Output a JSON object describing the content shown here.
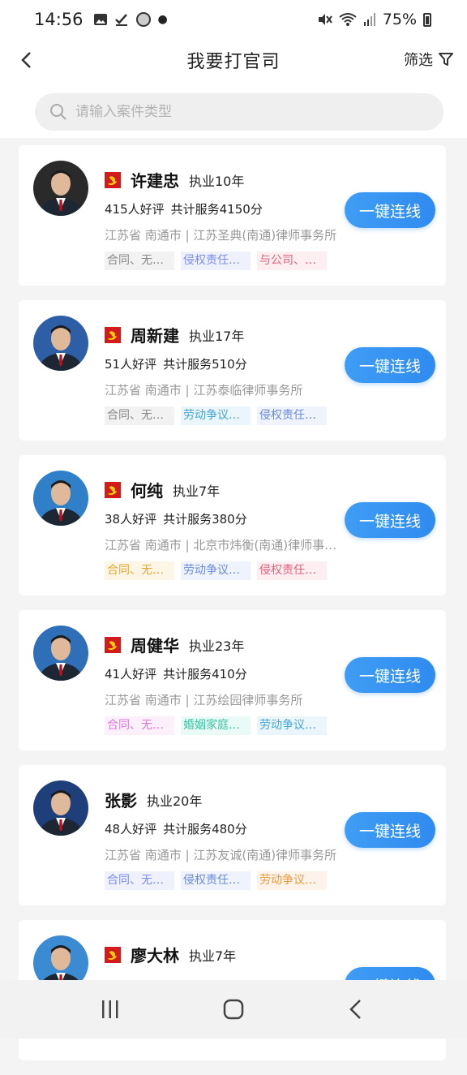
{
  "status": {
    "time": "14:56",
    "battery": "75%"
  },
  "header": {
    "title": "我要打官司",
    "filter_label": "筛选"
  },
  "search": {
    "placeholder": "请输入案件类型"
  },
  "connect_label": "一键连线",
  "lawyers": [
    {
      "name": "许建忠",
      "party": true,
      "years": "执业10年",
      "reviews": "415人好评",
      "service": "共计服务4150分",
      "location": "江苏省  南通市 | 江苏圣典(南通)律师事务所",
      "tags": [
        {
          "text": "合同、无…",
          "style": "gray"
        },
        {
          "text": "侵权责任…",
          "style": "bluepurple"
        },
        {
          "text": "与公司、…",
          "style": "red"
        }
      ]
    },
    {
      "name": "周新建",
      "party": true,
      "years": "执业17年",
      "reviews": "51人好评",
      "service": "共计服务510分",
      "location": "江苏省  南通市 | 江苏泰临律师事务所",
      "tags": [
        {
          "text": "合同、无…",
          "style": "gray"
        },
        {
          "text": "劳动争议…",
          "style": "teal"
        },
        {
          "text": "侵权责任…",
          "style": "blue"
        }
      ]
    },
    {
      "name": "何纯",
      "party": true,
      "years": "执业7年",
      "reviews": "38人好评",
      "service": "共计服务380分",
      "location": "江苏省  南通市 | 北京市炜衡(南通)律师事务所",
      "tags": [
        {
          "text": "合同、无…",
          "style": "yellow"
        },
        {
          "text": "劳动争议…",
          "style": "blue"
        },
        {
          "text": "侵权责任…",
          "style": "red"
        }
      ]
    },
    {
      "name": "周健华",
      "party": true,
      "years": "执业23年",
      "reviews": "41人好评",
      "service": "共计服务410分",
      "location": "江苏省  南通市 | 江苏绘园律师事务所",
      "tags": [
        {
          "text": "合同、无…",
          "style": "pink"
        },
        {
          "text": "婚姻家庭…",
          "style": "green"
        },
        {
          "text": "劳动争议…",
          "style": "teal"
        }
      ]
    },
    {
      "name": "张影",
      "party": false,
      "years": "执业20年",
      "reviews": "48人好评",
      "service": "共计服务480分",
      "location": "江苏省  南通市 | 江苏友诚(南通)律师事务所",
      "tags": [
        {
          "text": "合同、无…",
          "style": "bluepurple"
        },
        {
          "text": "侵权责任…",
          "style": "blue"
        },
        {
          "text": "劳动争议…",
          "style": "orange"
        }
      ]
    },
    {
      "name": "廖大林",
      "party": true,
      "years": "执业7年",
      "reviews": "",
      "service": "",
      "location": "",
      "tags": []
    }
  ],
  "colors": {
    "accent": "#2f8bef",
    "background": "#f4f4f4"
  }
}
